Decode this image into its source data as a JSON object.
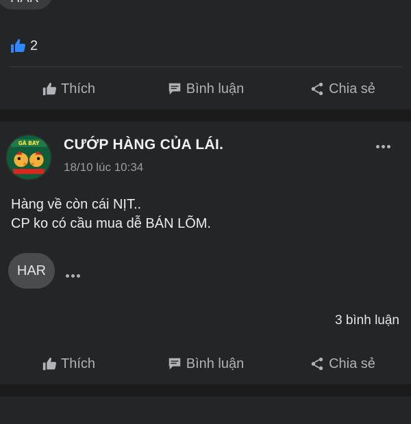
{
  "previous_post": {
    "sticker_label": "HAR",
    "like_count": "2",
    "actions": {
      "like": "Thích",
      "comment": "Bình luận",
      "share": "Chia sẻ"
    }
  },
  "post": {
    "author": "CƯỚP HÀNG CỦA LÁI.",
    "timestamp": "18/10 lúc 10:34",
    "avatar_text": "GÀ BAY",
    "body_line1": "Hàng về còn cái NỊT..",
    "body_line2": "CP ko có cầu mua dễ BÁN LÕM.",
    "sticker_label": "HAR",
    "comment_count": "3 bình luận",
    "actions": {
      "like": "Thích",
      "comment": "Bình luận",
      "share": "Chia sẻ"
    }
  },
  "colors": {
    "background": "#1b1b1b",
    "card": "#242526",
    "accent_blue": "#2d88ff",
    "muted_text": "#b0b3b8"
  },
  "icons": {
    "like": "thumbs-up-icon",
    "comment": "chat-bubble-icon",
    "share": "share-icon",
    "more": "more-dots-icon"
  }
}
